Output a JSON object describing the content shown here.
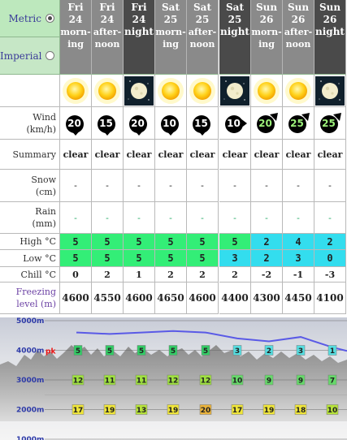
{
  "units": [
    {
      "label": "Metric",
      "selected": true
    },
    {
      "label": "Imperial",
      "selected": false
    }
  ],
  "columns": [
    {
      "day": "Fri",
      "date": "24",
      "period": [
        "morn-",
        "ing"
      ],
      "night": false
    },
    {
      "day": "Fri",
      "date": "24",
      "period": [
        "after-",
        "noon"
      ],
      "night": false
    },
    {
      "day": "Fri",
      "date": "24",
      "period": [
        "night"
      ],
      "night": true
    },
    {
      "day": "Sat",
      "date": "25",
      "period": [
        "morn-",
        "ing"
      ],
      "night": false
    },
    {
      "day": "Sat",
      "date": "25",
      "period": [
        "after-",
        "noon"
      ],
      "night": false
    },
    {
      "day": "Sat",
      "date": "25",
      "period": [
        "night"
      ],
      "night": true
    },
    {
      "day": "Sun",
      "date": "26",
      "period": [
        "morn-",
        "ing"
      ],
      "night": false
    },
    {
      "day": "Sun",
      "date": "26",
      "period": [
        "after-",
        "noon"
      ],
      "night": false
    },
    {
      "day": "Sun",
      "date": "26",
      "period": [
        "night"
      ],
      "night": true
    }
  ],
  "weather_icons": [
    "sun-icon",
    "sun-icon",
    "moon-icon",
    "sun-icon",
    "sun-icon",
    "moon-icon",
    "sun-icon",
    "sun-icon",
    "moon-icon"
  ],
  "rows": {
    "wind": {
      "label": [
        "Wind",
        "(km/h)"
      ],
      "values": [
        "20",
        "15",
        "20",
        "10",
        "15",
        "10",
        "20",
        "25",
        "25"
      ],
      "directions": [
        "down",
        "down",
        "down",
        "down",
        "down",
        "right",
        "up-right",
        "up-right",
        "up-right"
      ]
    },
    "summary": {
      "label": [
        "Summary"
      ],
      "values": [
        "clear",
        "clear",
        "clear",
        "clear",
        "clear",
        "clear",
        "clear",
        "clear",
        "clear"
      ]
    },
    "snow": {
      "label": [
        "Snow",
        "(cm)"
      ],
      "values": [
        "-",
        "-",
        "-",
        "-",
        "-",
        "-",
        "-",
        "-",
        "-"
      ]
    },
    "rain": {
      "label": [
        "Rain",
        "(mm)"
      ],
      "values": [
        "-",
        "-",
        "-",
        "-",
        "-",
        "-",
        "-",
        "-",
        "-"
      ]
    },
    "high": {
      "label": [
        "High °C"
      ],
      "values": [
        "5",
        "5",
        "5",
        "5",
        "5",
        "5",
        "2",
        "4",
        "2"
      ]
    },
    "low": {
      "label": [
        "Low °C"
      ],
      "values": [
        "5",
        "5",
        "5",
        "5",
        "5",
        "3",
        "2",
        "3",
        "0"
      ]
    },
    "chill": {
      "label": [
        "Chill °C"
      ],
      "values": [
        "0",
        "2",
        "1",
        "2",
        "2",
        "2",
        "-2",
        "-1",
        "-3"
      ]
    },
    "freezing": {
      "label": [
        "Freezing",
        "level (m)"
      ],
      "values": [
        "4600",
        "4550",
        "4600",
        "4650",
        "4600",
        "4400",
        "4300",
        "4450",
        "4100"
      ]
    }
  },
  "colors": {
    "warm_cell": "#33ee77",
    "cold_cell": "#33ddee",
    "units_bg": "#bde8bd",
    "header_day": "#8a8a8a",
    "header_night": "#4a4a4a"
  },
  "elevation_chart": {
    "altitudes": [
      "5000m",
      "4000m",
      "3000m",
      "2000m",
      "1000m"
    ],
    "peak_label": "pk",
    "levels": [
      {
        "altitude_m": 4000,
        "values": [
          "5",
          "5",
          "5",
          "5",
          "5",
          "3",
          "2",
          "3",
          "1"
        ]
      },
      {
        "altitude_m": 3000,
        "values": [
          "12",
          "11",
          "11",
          "12",
          "12",
          "10",
          "9",
          "9",
          "7"
        ]
      },
      {
        "altitude_m": 2000,
        "values": [
          "17",
          "19",
          "13",
          "19",
          "20",
          "17",
          "19",
          "18",
          "10"
        ]
      }
    ],
    "freezing_line_m": [
      4600,
      4550,
      4600,
      4650,
      4600,
      4400,
      4300,
      4450,
      4100
    ]
  }
}
